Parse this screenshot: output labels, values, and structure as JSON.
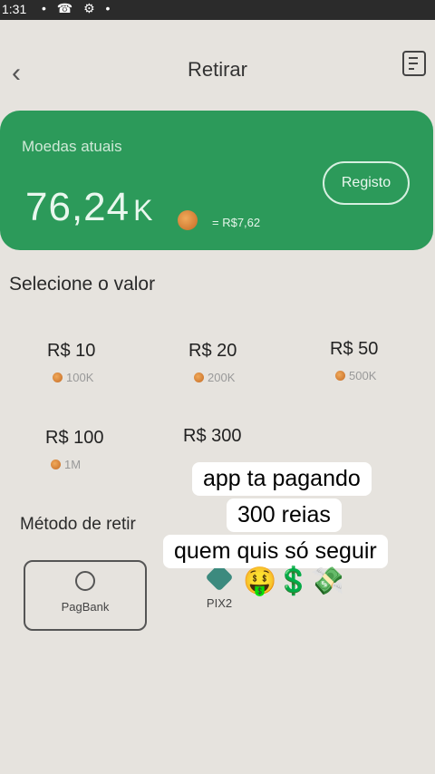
{
  "status": {
    "time": "1:31",
    "icons": "• ☎ ⚙ •"
  },
  "header": {
    "title": "Retirar",
    "back_icon": "‹"
  },
  "balance": {
    "label": "Moedas atuais",
    "value": "76,24",
    "unit": "K",
    "conversion": "= R$7,62",
    "history_button": "Registo",
    "card_color": "#2c9a5a"
  },
  "select_amount": {
    "title": "Selecione o valor",
    "options": [
      {
        "amount": "R$ 10",
        "coins": "100K"
      },
      {
        "amount": "R$ 20",
        "coins": "200K"
      },
      {
        "amount": "R$ 50",
        "coins": "500K"
      },
      {
        "amount": "R$ 100",
        "coins": "1M"
      },
      {
        "amount": "R$ 300",
        "coins": ""
      }
    ]
  },
  "withdraw_method": {
    "title": "Método de retir",
    "methods": [
      {
        "label": "PagBank",
        "selected": true
      },
      {
        "label": "PIX2",
        "selected": false
      }
    ]
  },
  "overlay_caption": {
    "line1": "app ta pagando",
    "line2": "300 reias",
    "line3": "quem quis só seguir",
    "emojis": "🤑💲💸"
  }
}
